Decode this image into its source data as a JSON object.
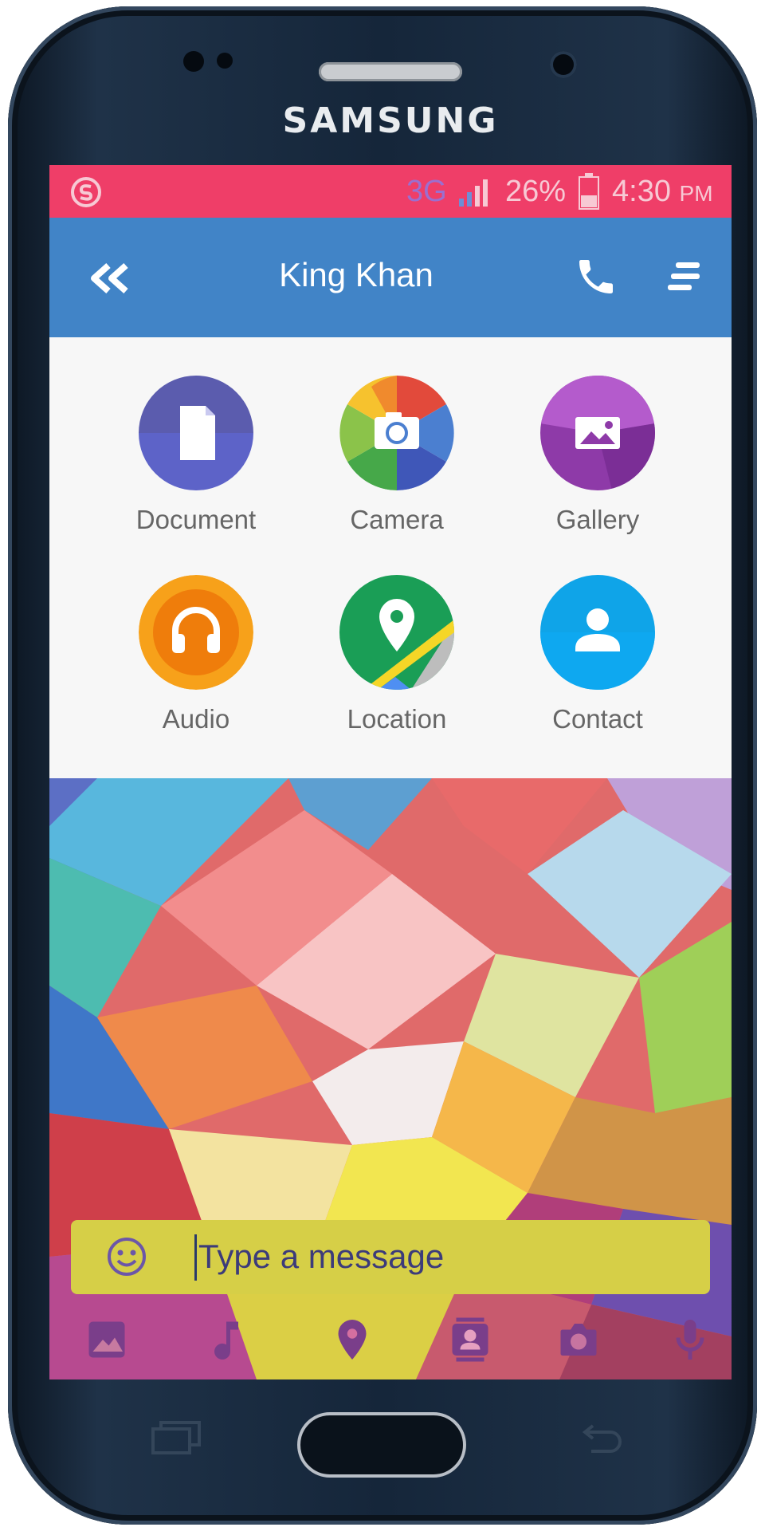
{
  "device": {
    "brand": "SAMSUNG"
  },
  "status_bar": {
    "network": "3G",
    "battery": "26%",
    "time": "4:30",
    "ampm": "PM",
    "color": "#ef3e68"
  },
  "app_bar": {
    "title": "King Khan",
    "color": "#4184c7",
    "back_icon": "double-chevron-left-icon",
    "call_icon": "phone-icon",
    "menu_icon": "menu-icon"
  },
  "attachments": [
    {
      "label": "Document",
      "icon": "document-icon"
    },
    {
      "label": "Camera",
      "icon": "camera-icon"
    },
    {
      "label": "Gallery",
      "icon": "image-icon"
    },
    {
      "label": "Audio",
      "icon": "headphones-icon"
    },
    {
      "label": "Location",
      "icon": "map-pin-icon"
    },
    {
      "label": "Contact",
      "icon": "person-icon"
    }
  ],
  "composer": {
    "placeholder": "Type a message",
    "emoji_icon": "smiley-icon"
  },
  "bottom_toolbar": [
    "image-icon",
    "music-note-icon",
    "location-pin-icon",
    "contact-card-icon",
    "camera-icon",
    "microphone-icon"
  ]
}
